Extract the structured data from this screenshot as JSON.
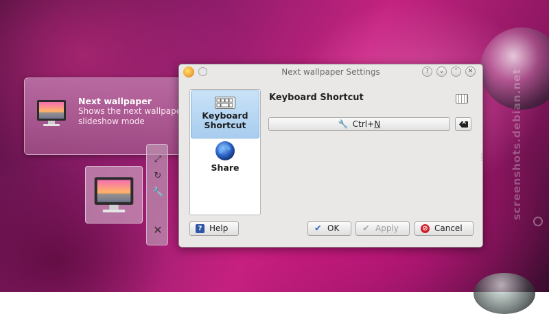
{
  "tooltip": {
    "title": "Next wallpaper",
    "description": "Shows the next wallpaper in slideshow mode"
  },
  "dialog": {
    "title": "Next wallpaper Settings",
    "sidebar": [
      {
        "label": "Keyboard Shortcut",
        "icon": "keyboard-icon",
        "selected": true
      },
      {
        "label": "Share",
        "icon": "globe-icon",
        "selected": false
      }
    ],
    "section_title": "Keyboard Shortcut",
    "shortcut_prefix": "Ctrl+",
    "shortcut_key": "N",
    "buttons": {
      "help": "Help",
      "ok": "OK",
      "apply": "Apply",
      "cancel": "Cancel"
    }
  },
  "watermark": "screenshots.debian.net",
  "colors": {
    "selection": "#a8cdef",
    "dialog_bg": "#e9e8e6",
    "ok_icon": "#3a6ec0",
    "cancel_icon": "#d0202a",
    "help_icon": "#2c55a6"
  }
}
